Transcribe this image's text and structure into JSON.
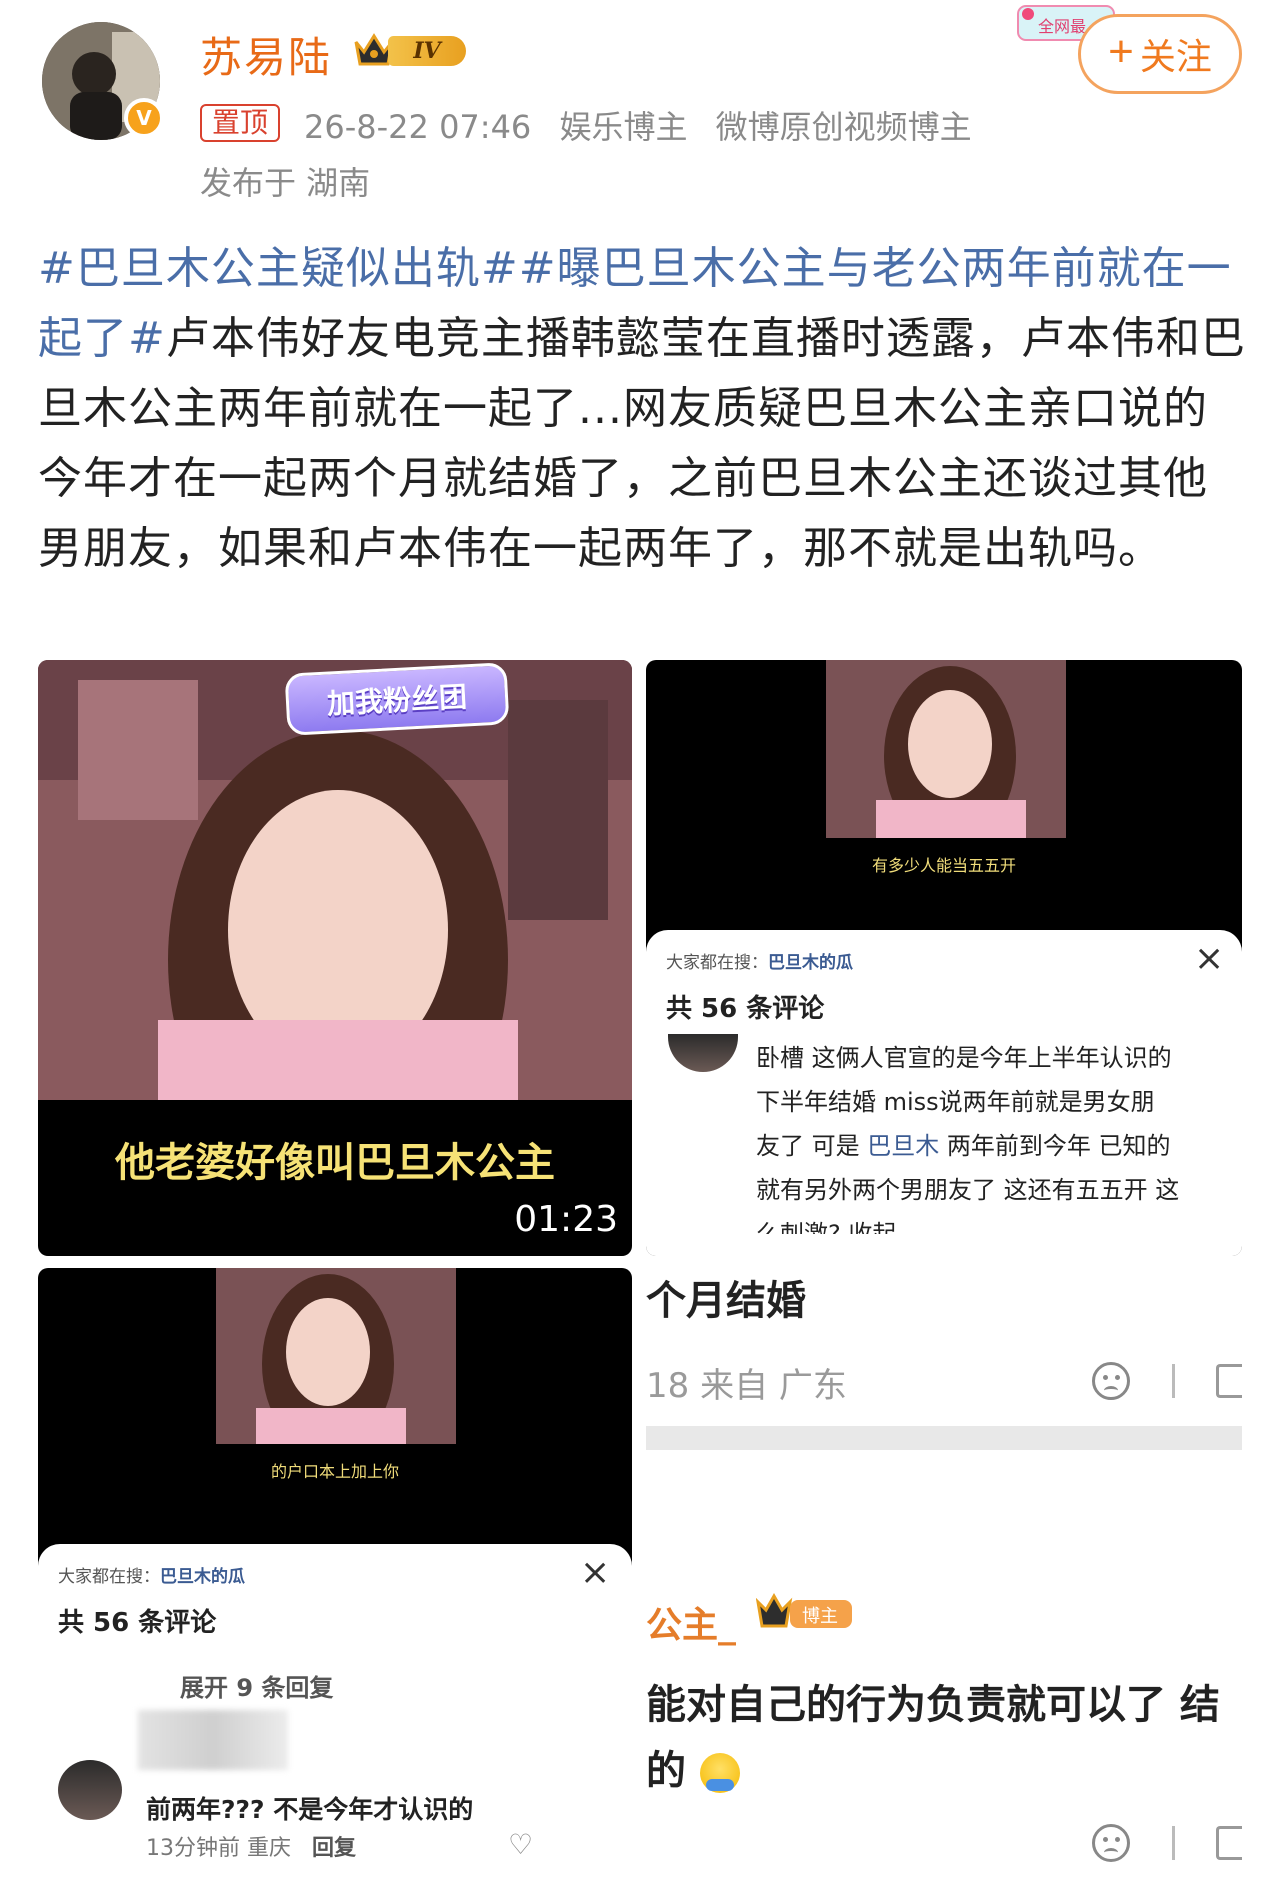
{
  "header": {
    "username": "苏易陆",
    "level": "IV",
    "pin_label": "置顶",
    "timestamp": "26-8-22 07:46",
    "tags": [
      "娱乐博主",
      "微博原创视频博主"
    ],
    "location": "发布于 湖南",
    "follow_label": "关注",
    "hot_badge": "全网最"
  },
  "post": {
    "hashtag1": "#巴旦木公主疑似出轨#",
    "hashtag2": "#曝巴旦木公主与老公两年前就在一起了#",
    "body": "卢本伟好友电竞主播韩懿莹在直播时透露，卢本伟和巴旦木公主两年前就在一起了...网友质疑巴旦木公主亲口说的今年才在一起两个月就结婚了，之前巴旦木公主还谈过其他男朋友，如果和卢本伟在一起两年了，那不就是出轨吗。"
  },
  "media": {
    "tile1": {
      "banner": "加我粉丝团",
      "subtitle": "他老婆好像叫巴旦木公主",
      "duration": "01:23"
    },
    "tile2": {
      "caption": "有多少人能当五五开",
      "search_prefix": "大家都在搜：",
      "search_term": "巴旦木的瓜",
      "comment_count": "共 56 条评论",
      "comment_l1": "卧槽 这俩人官宣的是今年上半年认识的",
      "comment_l2": "下半年结婚 miss说两年前就是男女朋",
      "comment_l3a": "友了 可是 ",
      "comment_l3_link": "巴旦木",
      "comment_l3b": " 两年前到今年 已知的",
      "comment_l4": "就有另外两个男朋友了 这还有五五开 这",
      "comment_l5": "么刺激? 收起"
    },
    "tile3": {
      "caption": "的户口本上加上你",
      "search_prefix": "大家都在搜：",
      "search_term": "巴旦木的瓜",
      "comment_count": "共 56 条评论",
      "expand_label": "展开 9 条回复",
      "reply_text": "前两年??? 不是今年才认识的",
      "reply_meta": "13分钟前 重庆",
      "reply_label": "回复"
    },
    "tile4": {
      "top_text": "个月结婚",
      "meta_text": "18  来自 广东",
      "name_text": "公主_",
      "badge_text": "博主",
      "line1": "能对自己的行为负责就可以了 结",
      "line2": "的"
    }
  },
  "colors": {
    "username": "#e86a17",
    "hashtag": "#4a6ea8",
    "pin": "#d9412e",
    "follow": "#f07a1f"
  }
}
